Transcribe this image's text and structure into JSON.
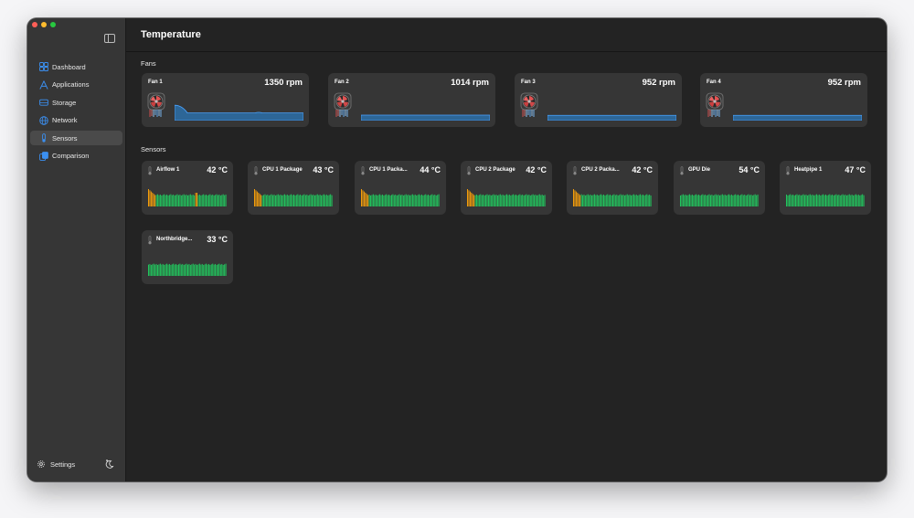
{
  "window": {
    "title": "Temperature"
  },
  "sidebar": {
    "items": [
      {
        "label": "Dashboard",
        "icon": "dashboard-icon"
      },
      {
        "label": "Applications",
        "icon": "applications-icon"
      },
      {
        "label": "Storage",
        "icon": "storage-icon"
      },
      {
        "label": "Network",
        "icon": "network-icon"
      },
      {
        "label": "Sensors",
        "icon": "sensors-icon",
        "active": true
      },
      {
        "label": "Comparison",
        "icon": "comparison-icon"
      }
    ],
    "settings_label": "Settings",
    "theme_icon": "theme-toggle-icon"
  },
  "sections": {
    "fans": "Fans",
    "sensors": "Sensors"
  },
  "fans": [
    {
      "name": "Fan 1",
      "rpm": "1350 rpm",
      "level": 0.35
    },
    {
      "name": "Fan 2",
      "rpm": "1014 rpm",
      "level": 0.25
    },
    {
      "name": "Fan 3",
      "rpm": "952 rpm",
      "level": 0.24
    },
    {
      "name": "Fan 4",
      "rpm": "952 rpm",
      "level": 0.24
    }
  ],
  "sensors": [
    {
      "name": "Airflow 1",
      "temp": "42 °C"
    },
    {
      "name": "CPU 1 Package",
      "temp": "43 °C"
    },
    {
      "name": "CPU 1 Packa...",
      "temp": "44 °C"
    },
    {
      "name": "CPU 2 Package",
      "temp": "42 °C"
    },
    {
      "name": "CPU 2 Packa...",
      "temp": "42 °C"
    },
    {
      "name": "GPU Die",
      "temp": "54 °C"
    },
    {
      "name": "Heatpipe 1",
      "temp": "47 °C"
    },
    {
      "name": "Northbridge...",
      "temp": "33 °C"
    }
  ],
  "colors": {
    "accent": "#3b8ff0",
    "graph_green": "#22c55e",
    "graph_orange": "#f59e0b",
    "fan_graph_blue": "#2b6ea8"
  }
}
